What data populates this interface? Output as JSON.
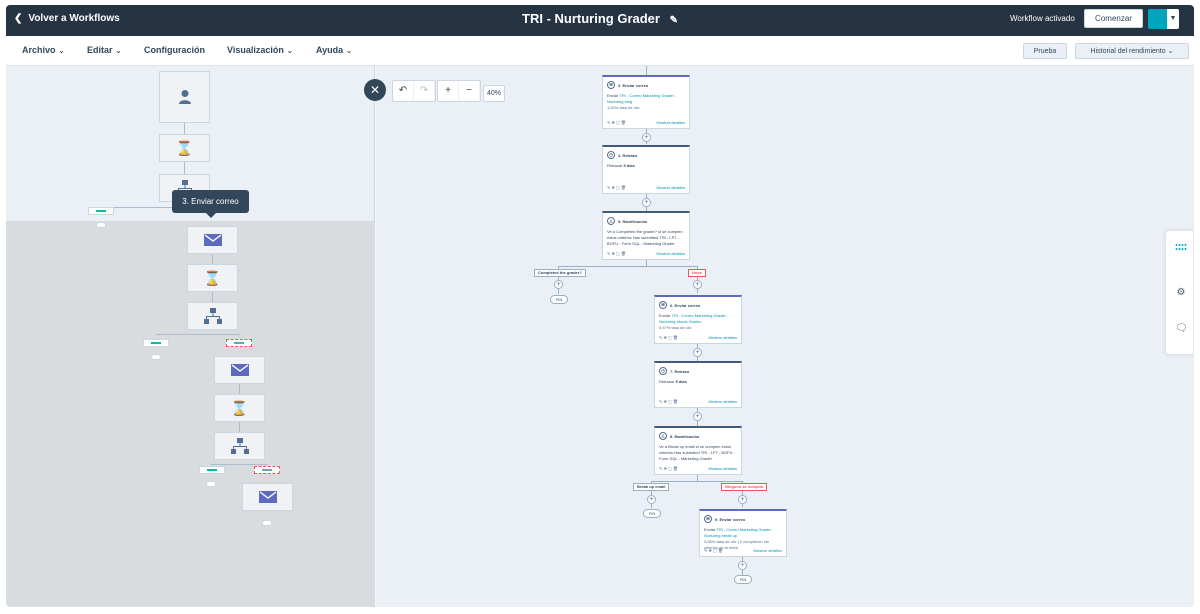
{
  "topbar": {
    "back_label": "Volver a Workflows",
    "title": "TRI - Nurturing Grader",
    "status": "Workflow activado",
    "start_button": "Comenzar"
  },
  "menu": {
    "items": [
      "Archivo",
      "Editar",
      "Configuración",
      "Visualización",
      "Ayuda"
    ],
    "test_button": "Prueba",
    "history_button": "Historial del rendimiento"
  },
  "minimap": {
    "tooltip": "3. Enviar correo"
  },
  "canvas": {
    "zoom": "40%",
    "cards": [
      {
        "id": "c3",
        "title": "3. Enviar correo",
        "line1_pre": "Enviar ",
        "line1_link": "TRI - Correo Marketing Grader - Nurturing blog",
        "line2": "1,62% tasa de clic",
        "details": "Mostrar detalles"
      },
      {
        "id": "c4",
        "title": "4. Retraso",
        "line1_pre": "Retrasar ",
        "line1_bold": "5 días",
        "details": "Mostrar detalles"
      },
      {
        "id": "c5",
        "title": "5. Ramificación",
        "text": "Ve a Completed the grader? si se cumplen estos criterios Has submitted TRI - LP7 - BOFU - Form SQL - Marketing Grader",
        "details": "Mostrar detalles"
      },
      {
        "id": "c6",
        "title": "6. Enviar correo",
        "line1_pre": "Enviar ",
        "line1_link": "TRI - Correo Marketing Grader - Nurturing ebook Grader",
        "line2": "0,57% tasa de clic",
        "details": "Mostrar detalles"
      },
      {
        "id": "c7",
        "title": "7. Retraso",
        "line1_pre": "Retrasar ",
        "line1_bold": "5 días",
        "details": "Mostrar detalles"
      },
      {
        "id": "c8",
        "title": "8. Ramificación",
        "text": "Ve a Break up email si se cumplen estos criterios Has submitted TRI - LP7 - BOFU - Form SQL - Marketing Grader",
        "details": "Mostrar detalles"
      },
      {
        "id": "c9",
        "title": "9. Enviar correo",
        "line1_pre": "Enviar ",
        "line1_link": "TRI - Correo Marketing Grader - Nurturing break up",
        "line2": "0,68% tasa de clic | 2 cumplieron los criterios de la meta",
        "details": "Mostrar detalles"
      }
    ],
    "branches": {
      "b1_yes": "Completed the grader?",
      "b1_no": "Nope",
      "b2_yes": "Break up email",
      "b2_no": "Ninguno se cumplió"
    },
    "end_label": "FIN"
  },
  "colors": {
    "topbar_bg": "#253342",
    "accent_teal": "#00a4bd",
    "link": "#0091ae",
    "email_accent": "#5c6bc0"
  }
}
